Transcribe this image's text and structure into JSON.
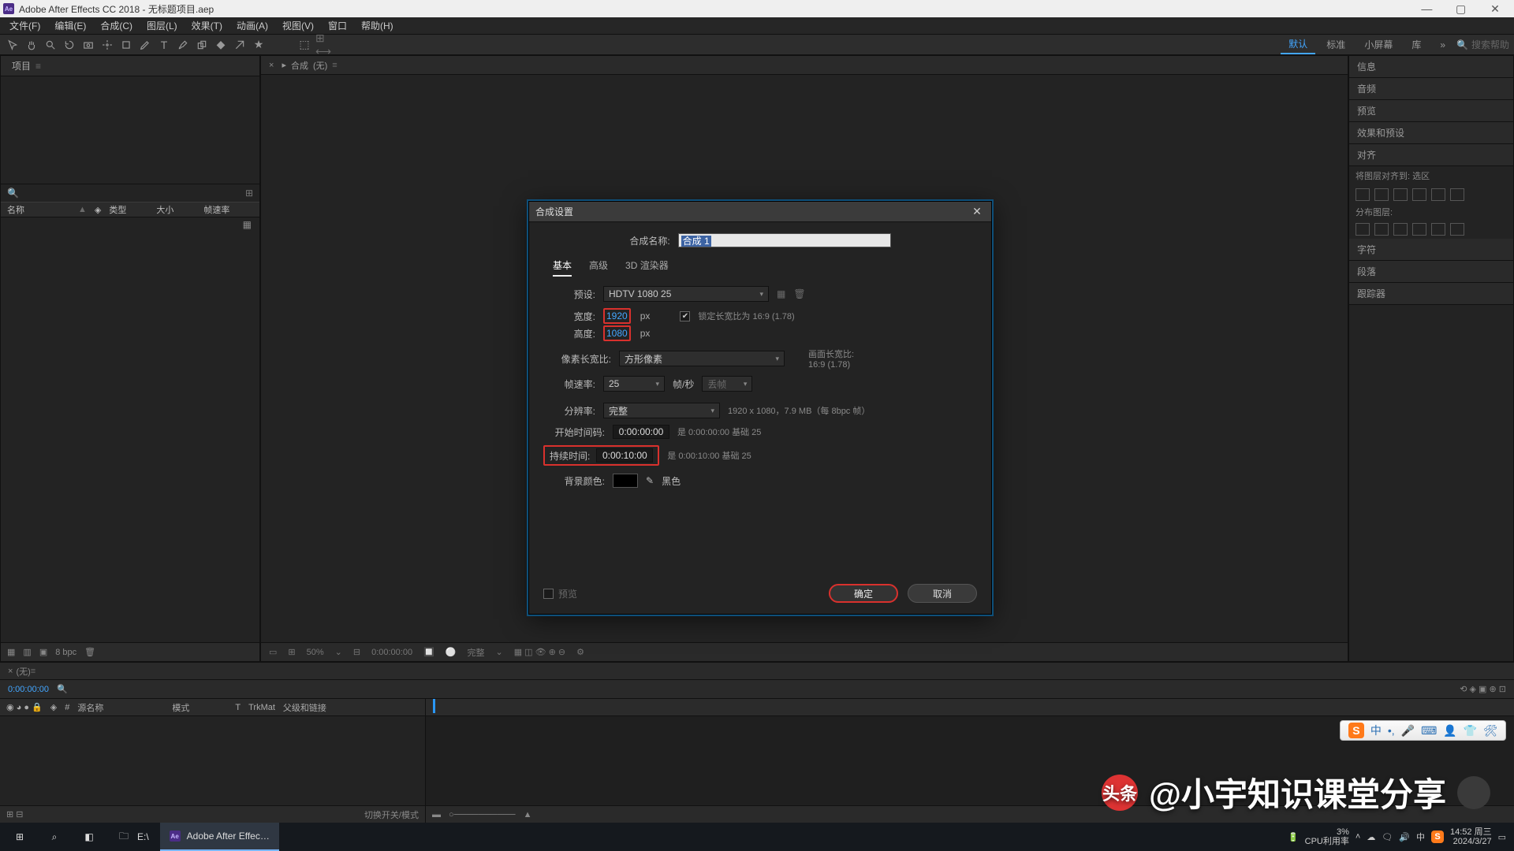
{
  "title": "Adobe After Effects CC 2018 - 无标题项目.aep",
  "menus": [
    "文件(F)",
    "编辑(E)",
    "合成(C)",
    "图层(L)",
    "效果(T)",
    "动画(A)",
    "视图(V)",
    "窗口",
    "帮助(H)"
  ],
  "workspaces": {
    "active": "默认",
    "items": [
      "默认",
      "标准",
      "小屏幕",
      "库"
    ]
  },
  "search_placeholder": "搜索帮助",
  "project_panel": {
    "tab": "项目",
    "headers": [
      "名称",
      "类型",
      "大小",
      "帧速率"
    ],
    "sort_icon": "▲",
    "footer_bpc": "8 bpc"
  },
  "comp_tab": {
    "prefix": "合成",
    "name": "(无)"
  },
  "viewer_footer": [
    "50%",
    "0:00:00:00",
    "完整",
    "⚙"
  ],
  "right_sections": [
    "信息",
    "音频",
    "预览",
    "效果和预设",
    "对齐",
    "字符",
    "段落",
    "跟踪器"
  ],
  "right_align_header": "将图层对齐到: 选区",
  "right_distribute": "分布图层:",
  "timeline": {
    "tab": "(无)",
    "hdr": [
      "源名称",
      "模式",
      "T",
      "父级和链接"
    ],
    "foot": "切换开关/模式"
  },
  "dialog": {
    "title": "合成设置",
    "name_label": "合成名称:",
    "name_value": "合成 1",
    "tabs": [
      "基本",
      "高级",
      "3D 渲染器"
    ],
    "tabs_active": "基本",
    "preset_label": "预设:",
    "preset_value": "HDTV 1080 25",
    "width_label": "宽度:",
    "width_value": "1920",
    "px": "px",
    "height_label": "高度:",
    "height_value": "1080",
    "lock_aspect": "锁定长宽比为 16:9 (1.78)",
    "par_label": "像素长宽比:",
    "par_value": "方形像素",
    "frame_aspect_label": "画面长宽比:",
    "frame_aspect_value": "16:9 (1.78)",
    "fps_label": "帧速率:",
    "fps_value": "25",
    "fps_unit": "帧/秒",
    "drop": "丢帧",
    "res_label": "分辨率:",
    "res_value": "完整",
    "res_info": "1920 x 1080，7.9 MB（每 8bpc 帧）",
    "start_label": "开始时间码:",
    "start_value": "0:00:00:00",
    "start_note": "是 0:00:00:00 基础 25",
    "dur_label": "持续时间:",
    "dur_value": "0:00:10:00",
    "dur_note": "是 0:00:10:00 基础 25",
    "bg_label": "背景颜色:",
    "bg_name": "黑色",
    "preview": "预览",
    "ok": "确定",
    "cancel": "取消"
  },
  "watermark": {
    "prefix": "头条",
    "text": "@小宇知识课堂分享"
  },
  "taskbar": {
    "explorer": "E:\\",
    "app": "Adobe After Effec…",
    "cpu_label": "CPU利用率",
    "cpu_pct": "3%",
    "time": "14:52",
    "weekday": "周三",
    "date": "2024/3/27"
  }
}
